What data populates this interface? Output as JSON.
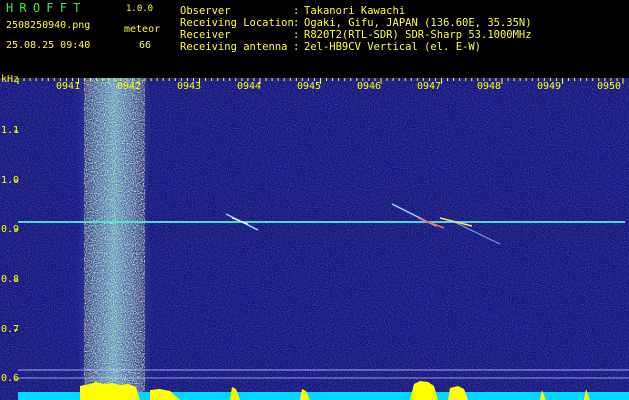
{
  "header": {
    "app_title": "HROFFT",
    "app_version": "1.0.0",
    "file_name": "2508250940.png",
    "meteor_label": "meteor",
    "date_time": "25.08.25 09:40",
    "meteor_count": "66",
    "info": [
      {
        "label": "Observer",
        "value": "Takanori Kawachi"
      },
      {
        "label": "Receiving Location",
        "value": "Ogaki, Gifu, JAPAN (136.60E, 35.35N)"
      },
      {
        "label": "Receiver",
        "value": "R820T2(RTL-SDR) SDR-Sharp 53.1000MHz"
      },
      {
        "label": "Receiving antenna",
        "value": "2el-HB9CV Vertical (el. E-W)"
      }
    ]
  },
  "axes": {
    "y_unit": "kHz",
    "x_ticks": [
      "0941",
      "0942",
      "0943",
      "0944",
      "0945",
      "0946",
      "0947",
      "0948",
      "0949",
      "0950"
    ],
    "y_ticks": [
      "1.1",
      "1.0",
      "0.9",
      "0.8",
      "0.7",
      "0.6"
    ]
  },
  "colors": {
    "background": "#000000",
    "spectrogram_bg": "#14147a",
    "header_green": "#43e543",
    "header_yellow": "#ffff40",
    "header_cyan": "#00ffff",
    "tick_yellow": "#ffff00",
    "signal_line": "#3fe8d0",
    "level_yellow": "#ffff00",
    "level_cyan": "#00d8ff"
  }
}
